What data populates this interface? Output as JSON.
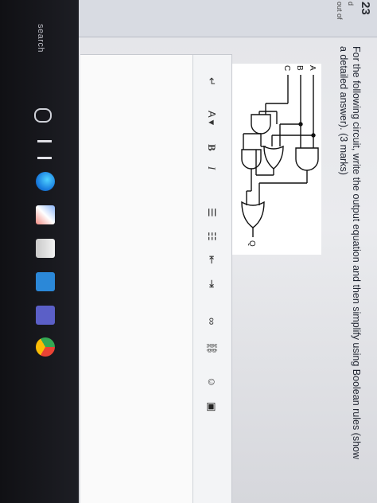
{
  "sidebar": {
    "question_number": "23",
    "status_fragment": "d",
    "points_fragment": "out of"
  },
  "question": {
    "line1": "For the following circuit, write the output equation and then simplify using Boolean rules (show",
    "line2": "a detailed answer). (3 marks)"
  },
  "circuit": {
    "inputs": [
      "A",
      "B",
      "C"
    ],
    "output": "Q"
  },
  "toolbar": {
    "paragraph": "↵",
    "font_color": "A ▾",
    "bold": "B",
    "italic": "I",
    "bullets": "☰",
    "numbered": "☷",
    "outdent": "⇤",
    "indent": "⇥",
    "link": "∞",
    "unlink": "⛓",
    "emoji": "☺",
    "image": "▣"
  },
  "taskbar": {
    "search_label": "search",
    "icons": [
      "mic-icon",
      "task-view-icon",
      "edge-icon",
      "store-icon",
      "calendar-icon",
      "mail-icon",
      "teams-icon",
      "chrome-icon"
    ]
  },
  "colors": {
    "screen_bg": "#e4e5e9",
    "taskbar_bg": "#15151a",
    "text": "#1f2430"
  }
}
